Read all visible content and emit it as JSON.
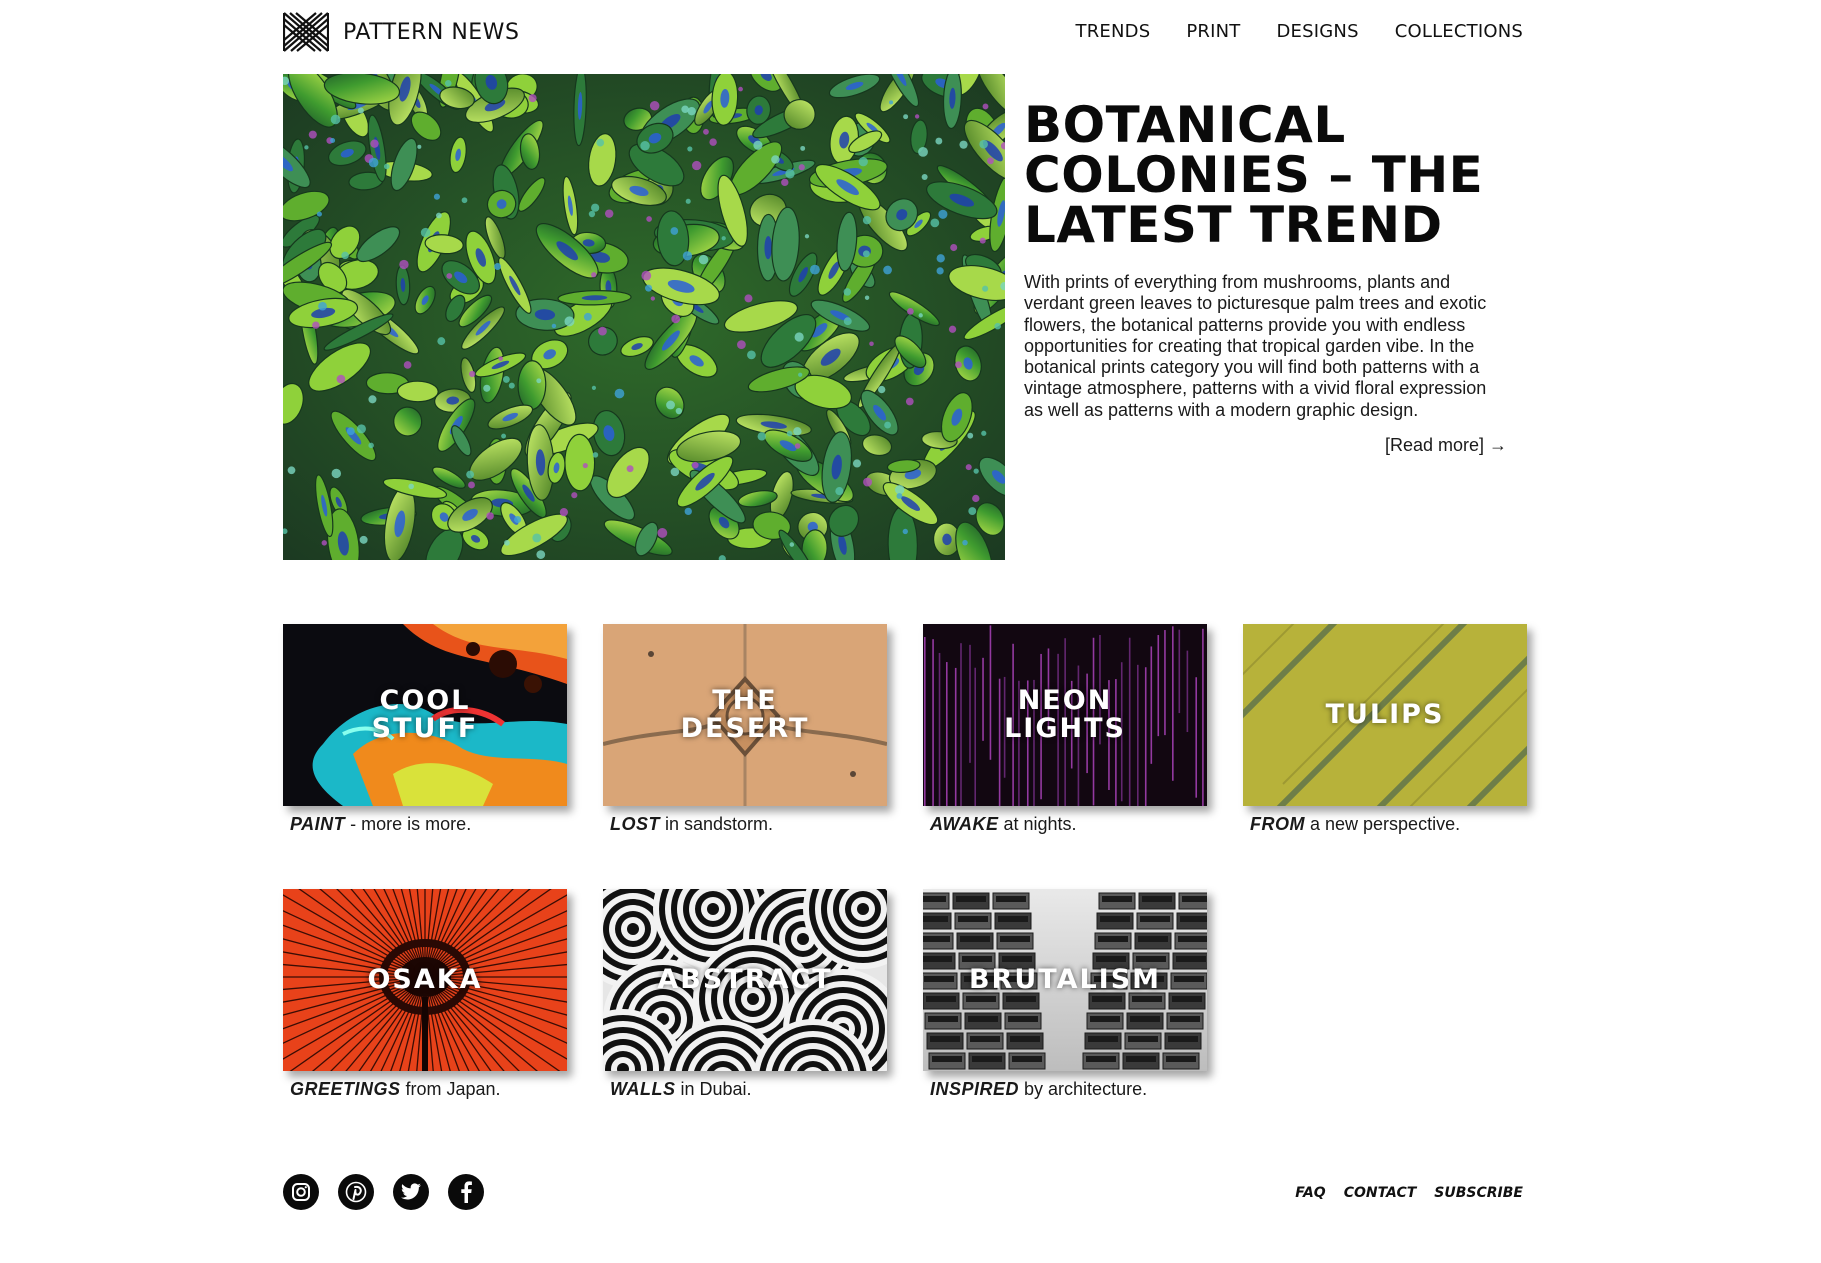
{
  "brand": {
    "name": "PATTERN NEWS",
    "logo_icon": "pattern-x-logo"
  },
  "nav": {
    "items": [
      "TRENDS",
      "PRINT",
      "DESIGNS",
      "COLLECTIONS"
    ]
  },
  "hero": {
    "title_lines": [
      "BOTANICAL",
      "COLONIES – THE",
      "LATEST TREND"
    ],
    "body": "With prints of everything from mushrooms, plants and verdant green leaves to picturesque palm trees and exotic flowers, the botanical patterns provide you with endless opportunities for creating that tropical garden vibe. In the botanical prints category you will find both patterns with a vintage atmosphere, patterns with a vivid floral expression as well as patterns with a modern graphic design.",
    "read_more": "[Read more] →"
  },
  "tiles": [
    {
      "label": "COOL\nSTUFF",
      "caption_bold": "PAINT",
      "caption_rest": " - more is more."
    },
    {
      "label": "THE\nDESERT",
      "caption_bold": "LOST",
      "caption_rest": " in sandstorm."
    },
    {
      "label": "NEON\nLIGHTS",
      "caption_bold": "AWAKE",
      "caption_rest": " at nights."
    },
    {
      "label": "TULIPS",
      "caption_bold": "FROM",
      "caption_rest": " a new perspective."
    },
    {
      "label": "OSAKA",
      "caption_bold": "GREETINGS",
      "caption_rest": " from Japan."
    },
    {
      "label": "ABSTRACT",
      "caption_bold": "WALLS",
      "caption_rest": " in Dubai."
    },
    {
      "label": "BRUTALISM",
      "caption_bold": "INSPIRED",
      "caption_rest": " by architecture."
    }
  ],
  "social": [
    "instagram-icon",
    "pinterest-icon",
    "twitter-icon",
    "facebook-icon"
  ],
  "footer": {
    "links": [
      "FAQ",
      "CONTACT",
      "SUBSCRIBE"
    ]
  }
}
